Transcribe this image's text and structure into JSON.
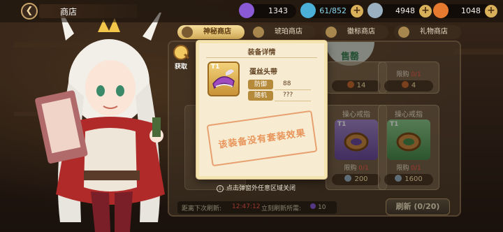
{
  "header": {
    "back_icon": "back-arrow-icon",
    "title": "商店",
    "currencies": [
      {
        "icon": "purple-crystal-icon",
        "value": "1343",
        "color": "#8a5ad6"
      },
      {
        "icon": "stamina-bottle-icon",
        "value": "61/852",
        "color": "#4ab0d8"
      },
      {
        "icon": "gear-coin-icon",
        "value": "4948",
        "color": "#9ab0c0"
      },
      {
        "icon": "carrot-icon",
        "value": "1048",
        "color": "#e87a30"
      }
    ]
  },
  "tabs": [
    {
      "label": "神秘商店",
      "active": true
    },
    {
      "label": "琥珀商店",
      "active": false
    },
    {
      "label": "徽标商店",
      "active": false
    },
    {
      "label": "礼物商店",
      "active": false
    }
  ],
  "get_button": {
    "label": "获取"
  },
  "cards": {
    "top_right_sold": "售罄",
    "top_middle_price": "14",
    "top_right_limit": {
      "label": "限购",
      "count": "0/1"
    },
    "top_right_price": "4",
    "bottom_middle": {
      "name": "操心戒指",
      "tier": "T1",
      "limit_label": "限购",
      "limit_count": "0/1",
      "price": "200"
    },
    "bottom_right": {
      "name": "操心戒指",
      "tier": "T1",
      "limit_label": "限购",
      "limit_count": "0/1",
      "price": "1600"
    }
  },
  "popup": {
    "title": "装备详情",
    "item_tier": "T1",
    "item_name": "蛋丝头带",
    "stats": [
      {
        "label": "防御",
        "value": "88"
      },
      {
        "label": "随机",
        "value": "???"
      }
    ],
    "stamp_text": "该装备没有套装效果"
  },
  "hint": "点击弹窗外任意区域关闭",
  "footer": {
    "next_refresh_label": "距离下次刷新:",
    "next_refresh_time": "12:47:12",
    "refresh_cost_label": "立刻刷新所需:",
    "refresh_cost": "10",
    "refresh_button": "刷新 (0/20)"
  }
}
